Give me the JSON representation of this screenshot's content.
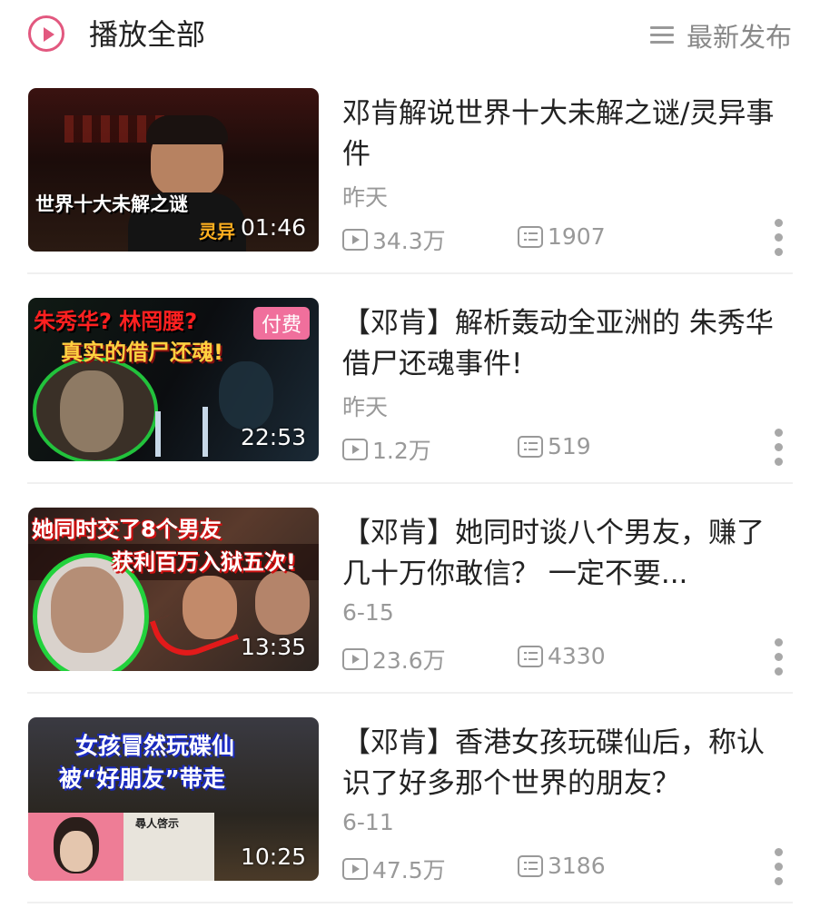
{
  "header": {
    "play_all_label": "播放全部",
    "sort_label": "最新发布"
  },
  "videos": [
    {
      "title": "邓肯解说世界十大未解之谜/灵异事件",
      "date": "昨天",
      "views": "34.3万",
      "danmaku": "1907",
      "duration": "01:46",
      "paid": false,
      "thumb_text_1": "世界十大未解之谜",
      "thumb_text_2": "灵异"
    },
    {
      "title": "【邓肯】解析轰动全亚洲的 朱秀华借尸还魂事件!",
      "date": "昨天",
      "views": "1.2万",
      "danmaku": "519",
      "duration": "22:53",
      "paid": true,
      "paid_label": "付费",
      "thumb_text_1": "朱秀华? 林罔腰?",
      "thumb_text_2": "真实的借尸还魂!"
    },
    {
      "title": "【邓肯】她同时谈八个男友，赚了几十万你敢信？ 一定不要...",
      "date": "6-15",
      "views": "23.6万",
      "danmaku": "4330",
      "duration": "13:35",
      "paid": false,
      "thumb_text_1": "她同时交了8个男友",
      "thumb_text_2": "获利百万入狱五次!"
    },
    {
      "title": "【邓肯】香港女孩玩碟仙后，称认识了好多那个世界的朋友？",
      "date": "6-11",
      "views": "47.5万",
      "danmaku": "3186",
      "duration": "10:25",
      "paid": false,
      "thumb_text_1": "女孩冒然玩碟仙",
      "thumb_text_2": "被“好朋友”带走",
      "thumb_text_3": "尋人啓示"
    }
  ]
}
